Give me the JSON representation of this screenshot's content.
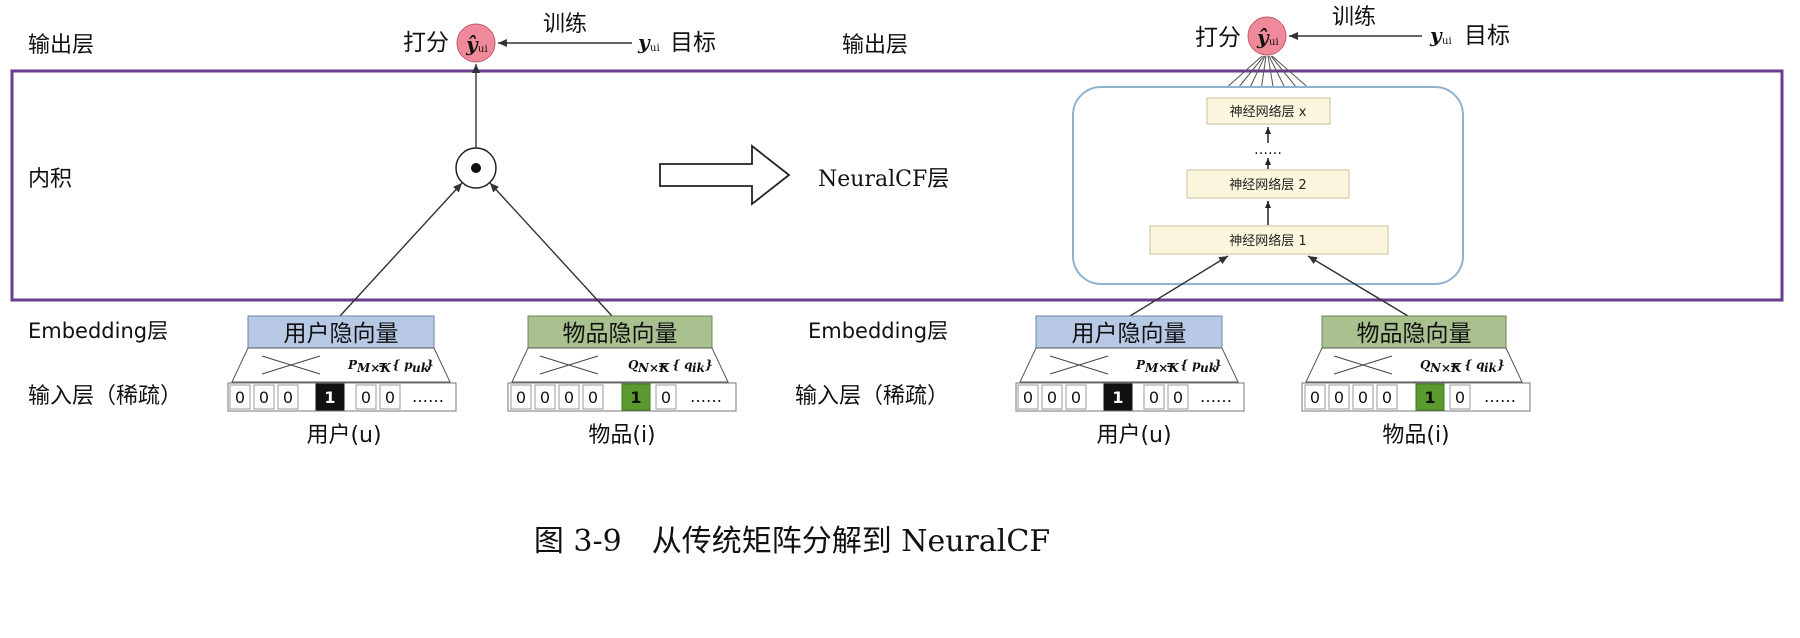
{
  "labels": {
    "output_layer": "输出层",
    "inner_product": "内积",
    "embedding_layer": "Embedding层",
    "input_layer": "输入层（稀疏）",
    "neuralcf_layer": "NeuralCF层",
    "score": "打分",
    "train": "训练",
    "target": "目标",
    "y_hat": "ŷ",
    "y_hat_sub": "ui",
    "y": "y",
    "y_sub": "ui"
  },
  "left": {
    "user_vector": "用户隐向量",
    "item_vector": "物品隐向量",
    "user_eq": "P",
    "user_eq_sub": "M×K",
    "user_eq_rhs": "= { p",
    "user_eq_rhs_sub": "uk",
    "user_eq_close": "}",
    "item_eq": "Q",
    "item_eq_sub": "N×K",
    "item_eq_rhs": "= { q",
    "item_eq_rhs_sub": "ik",
    "item_eq_close": "}",
    "user_cells": [
      "0",
      "0",
      "0",
      "1",
      "0",
      "0",
      "……"
    ],
    "item_cells": [
      "0",
      "0",
      "0",
      "0",
      "1",
      "0",
      "……"
    ],
    "user_caption": "用户(u)",
    "item_caption": "物品(i)"
  },
  "right": {
    "user_vector": "用户隐向量",
    "item_vector": "物品隐向量",
    "user_eq": "P",
    "user_eq_sub": "M×K",
    "user_eq_rhs": "= { p",
    "user_eq_rhs_sub": "uk",
    "user_eq_close": "}",
    "item_eq": "Q",
    "item_eq_sub": "N×K",
    "item_eq_rhs": "= { q",
    "item_eq_rhs_sub": "ik",
    "item_eq_close": "}",
    "user_cells": [
      "0",
      "0",
      "0",
      "1",
      "0",
      "0",
      "……"
    ],
    "item_cells": [
      "0",
      "0",
      "0",
      "0",
      "1",
      "0",
      "……"
    ],
    "user_caption": "用户(u)",
    "item_caption": "物品(i)",
    "nn_layer_x": "神经网络层 x",
    "nn_dots": "……",
    "nn_layer_2": "神经网络层 2",
    "nn_layer_1": "神经网络层 1"
  },
  "caption": "图 3-9　从传统矩阵分解到 NeuralCF",
  "colors": {
    "frame": "#6a3d8f",
    "user_header": "#b8c9e6",
    "item_header": "#a9c08f",
    "one_user": "#111111",
    "one_item": "#5a9a2f",
    "score_node": "#f08a9a",
    "nn_box": "#8fb3cf",
    "nn_layer": "#fbf6dd"
  }
}
